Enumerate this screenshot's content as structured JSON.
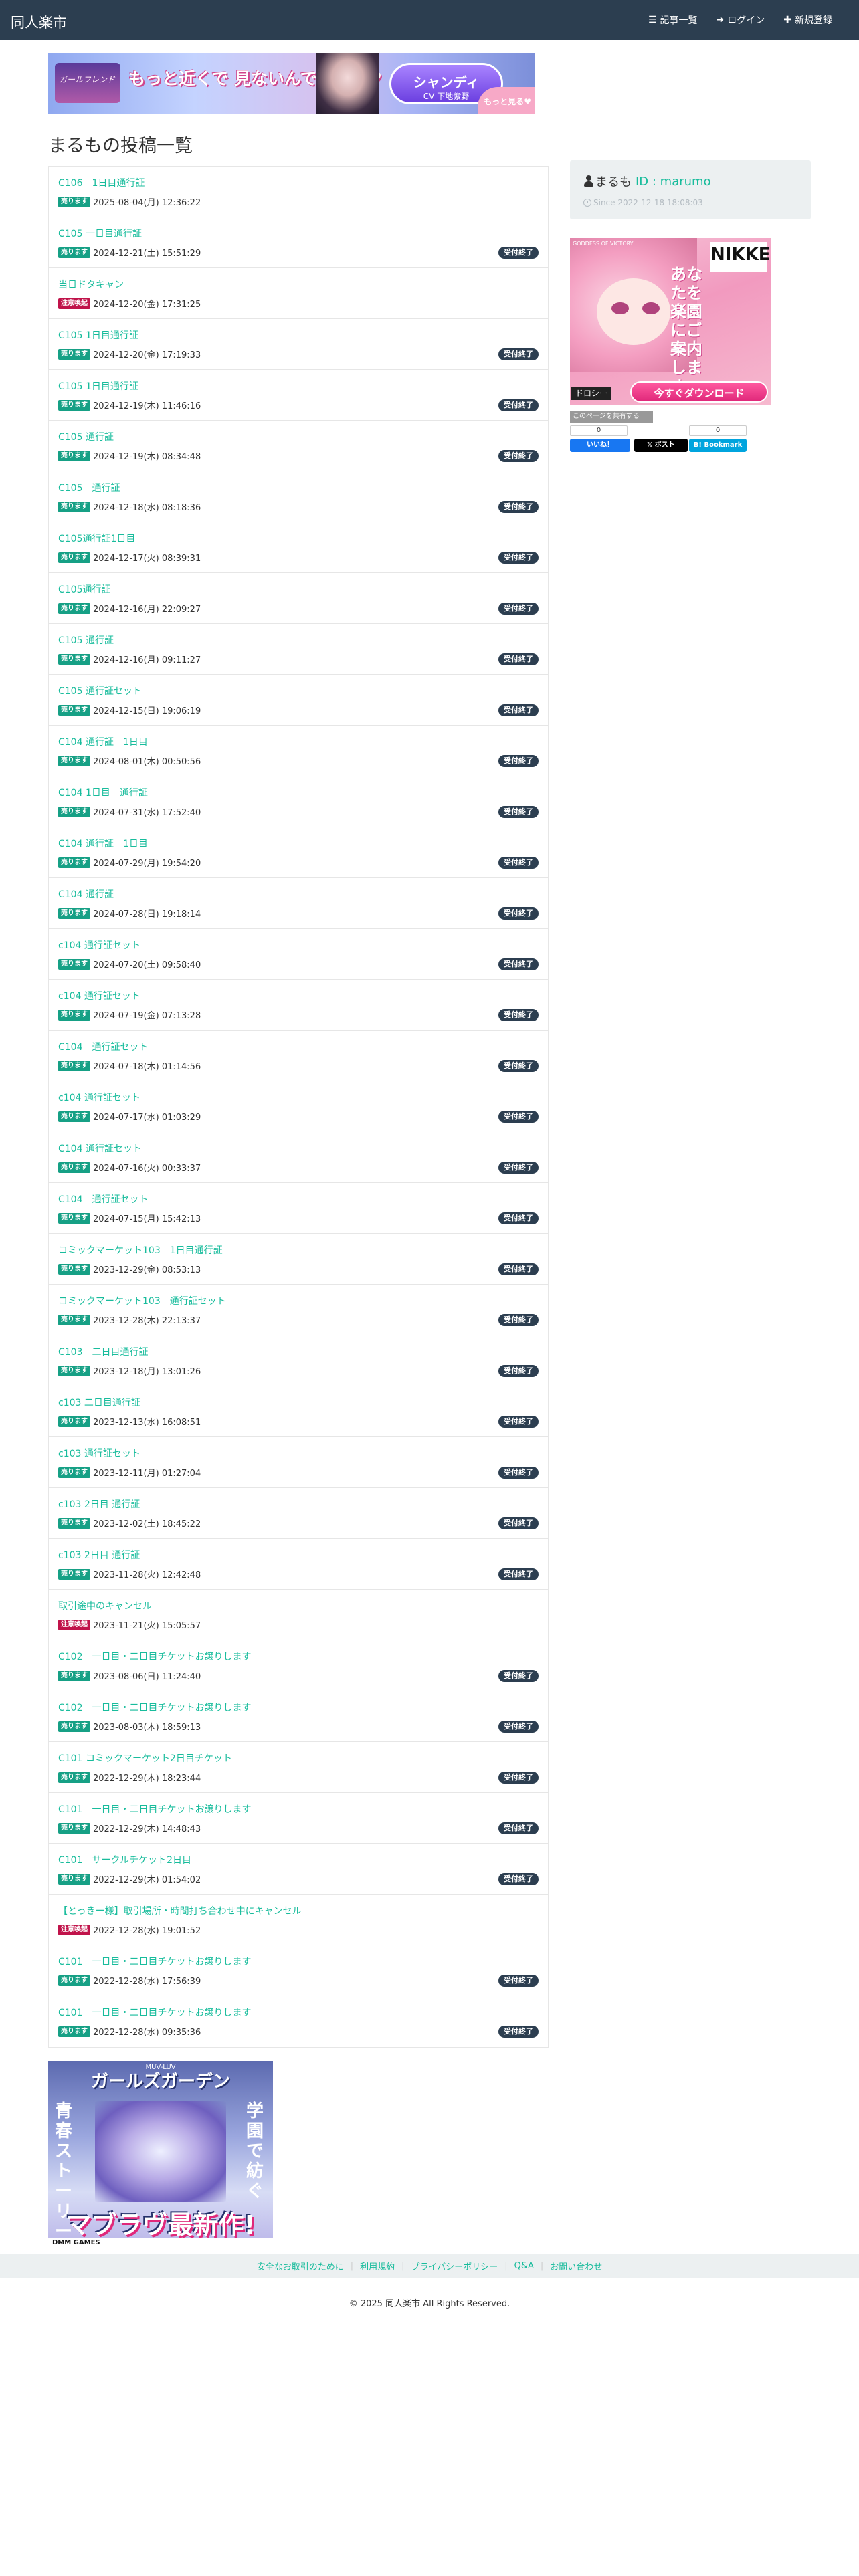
{
  "navbar": {
    "brand": "同人楽市",
    "links": [
      {
        "label": "記事一覧",
        "icon": "list-icon"
      },
      {
        "label": "ログイン",
        "icon": "login-icon"
      },
      {
        "label": "新規登録",
        "icon": "plus-icon"
      }
    ]
  },
  "ads": {
    "top_banner": {
      "logo": "ガールフレンド",
      "copy": "もっと近くで 見ないんですか？♥",
      "pill": "シャンディ",
      "pill_sub": "CV 下地紫野",
      "corner": "もっと見る♥"
    },
    "side": {
      "logo": "NIKKE",
      "tagline": "GODDESS OF VICTORY",
      "copy": "あなたを楽園にご案内します",
      "name": "ドロシー",
      "cta": "今すぐダウンロード"
    },
    "bottom": {
      "sub": "MUV-LUV",
      "title": "ガールズガーデン",
      "left": "青春ストーリー",
      "right": "学園で紡ぐ",
      "logo": "マブラヴ最新作!",
      "foot": "DMM GAMES"
    }
  },
  "page_title": "まるもの投稿一覧",
  "posts": [
    {
      "title": "C106　1日目通行証",
      "type": "売ります",
      "type_color": "#16a085",
      "date": "2025-08-04(月) 12:36:22",
      "status": ""
    },
    {
      "title": "C105 一日目通行証",
      "type": "売ります",
      "type_color": "#16a085",
      "date": "2024-12-21(土) 15:51:29",
      "status": "受付終了"
    },
    {
      "title": "当日ドタキャン",
      "type": "注意喚起",
      "type_color": "#c0134a",
      "date": "2024-12-20(金) 17:31:25",
      "status": ""
    },
    {
      "title": "C105 1日目通行証",
      "type": "売ります",
      "type_color": "#16a085",
      "date": "2024-12-20(金) 17:19:33",
      "status": "受付終了"
    },
    {
      "title": "C105 1日目通行証",
      "type": "売ります",
      "type_color": "#16a085",
      "date": "2024-12-19(木) 11:46:16",
      "status": "受付終了"
    },
    {
      "title": "C105 通行証",
      "type": "売ります",
      "type_color": "#16a085",
      "date": "2024-12-19(木) 08:34:48",
      "status": "受付終了"
    },
    {
      "title": "C105　通行証",
      "type": "売ります",
      "type_color": "#16a085",
      "date": "2024-12-18(水) 08:18:36",
      "status": "受付終了"
    },
    {
      "title": "C105通行証1日目",
      "type": "売ります",
      "type_color": "#16a085",
      "date": "2024-12-17(火) 08:39:31",
      "status": "受付終了"
    },
    {
      "title": "C105通行証",
      "type": "売ります",
      "type_color": "#16a085",
      "date": "2024-12-16(月) 22:09:27",
      "status": "受付終了"
    },
    {
      "title": "C105 通行証",
      "type": "売ります",
      "type_color": "#16a085",
      "date": "2024-12-16(月) 09:11:27",
      "status": "受付終了"
    },
    {
      "title": "C105 通行証セット",
      "type": "売ります",
      "type_color": "#16a085",
      "date": "2024-12-15(日) 19:06:19",
      "status": "受付終了"
    },
    {
      "title": "C104 通行証　1日目",
      "type": "売ります",
      "type_color": "#16a085",
      "date": "2024-08-01(木) 00:50:56",
      "status": "受付終了"
    },
    {
      "title": "C104 1日目　通行証",
      "type": "売ります",
      "type_color": "#16a085",
      "date": "2024-07-31(水) 17:52:40",
      "status": "受付終了"
    },
    {
      "title": "C104 通行証　1日目",
      "type": "売ります",
      "type_color": "#16a085",
      "date": "2024-07-29(月) 19:54:20",
      "status": "受付終了"
    },
    {
      "title": "C104 通行証",
      "type": "売ります",
      "type_color": "#16a085",
      "date": "2024-07-28(日) 19:18:14",
      "status": "受付終了"
    },
    {
      "title": "c104 通行証セット",
      "type": "売ります",
      "type_color": "#16a085",
      "date": "2024-07-20(土) 09:58:40",
      "status": "受付終了"
    },
    {
      "title": "c104 通行証セット",
      "type": "売ります",
      "type_color": "#16a085",
      "date": "2024-07-19(金) 07:13:28",
      "status": "受付終了"
    },
    {
      "title": "C104　通行証セット",
      "type": "売ります",
      "type_color": "#16a085",
      "date": "2024-07-18(木) 01:14:56",
      "status": "受付終了"
    },
    {
      "title": "c104 通行証セット",
      "type": "売ります",
      "type_color": "#16a085",
      "date": "2024-07-17(水) 01:03:29",
      "status": "受付終了"
    },
    {
      "title": "C104 通行証セット",
      "type": "売ります",
      "type_color": "#16a085",
      "date": "2024-07-16(火) 00:33:37",
      "status": "受付終了"
    },
    {
      "title": "C104　通行証セット",
      "type": "売ります",
      "type_color": "#16a085",
      "date": "2024-07-15(月) 15:42:13",
      "status": "受付終了"
    },
    {
      "title": "コミックマーケット103　1日目通行証",
      "type": "売ります",
      "type_color": "#16a085",
      "date": "2023-12-29(金) 08:53:13",
      "status": "受付終了"
    },
    {
      "title": "コミックマーケット103　通行証セット",
      "type": "売ります",
      "type_color": "#16a085",
      "date": "2023-12-28(木) 22:13:37",
      "status": "受付終了"
    },
    {
      "title": "C103　二日目通行証",
      "type": "売ります",
      "type_color": "#16a085",
      "date": "2023-12-18(月) 13:01:26",
      "status": "受付終了"
    },
    {
      "title": "c103 二日目通行証",
      "type": "売ります",
      "type_color": "#16a085",
      "date": "2023-12-13(水) 16:08:51",
      "status": "受付終了"
    },
    {
      "title": "c103 通行証セット",
      "type": "売ります",
      "type_color": "#16a085",
      "date": "2023-12-11(月) 01:27:04",
      "status": "受付終了"
    },
    {
      "title": "c103 2日目 通行証",
      "type": "売ります",
      "type_color": "#16a085",
      "date": "2023-12-02(土) 18:45:22",
      "status": "受付終了"
    },
    {
      "title": "c103 2日目 通行証",
      "type": "売ります",
      "type_color": "#16a085",
      "date": "2023-11-28(火) 12:42:48",
      "status": "受付終了"
    },
    {
      "title": "取引途中のキャンセル",
      "type": "注意喚起",
      "type_color": "#c0134a",
      "date": "2023-11-21(火) 15:05:57",
      "status": ""
    },
    {
      "title": "C102　一日目・二日目チケットお譲りします",
      "type": "売ります",
      "type_color": "#16a085",
      "date": "2023-08-06(日) 11:24:40",
      "status": "受付終了"
    },
    {
      "title": "C102　一日目・二日目チケットお譲りします",
      "type": "売ります",
      "type_color": "#16a085",
      "date": "2023-08-03(木) 18:59:13",
      "status": "受付終了"
    },
    {
      "title": "C101 コミックマーケット2日目チケット",
      "type": "売ります",
      "type_color": "#16a085",
      "date": "2022-12-29(木) 18:23:44",
      "status": "受付終了"
    },
    {
      "title": "C101　一日目・二日目チケットお譲りします",
      "type": "売ります",
      "type_color": "#16a085",
      "date": "2022-12-29(木) 14:48:43",
      "status": "受付終了"
    },
    {
      "title": "C101　サークルチケット2日目",
      "type": "売ります",
      "type_color": "#16a085",
      "date": "2022-12-29(木) 01:54:02",
      "status": "受付終了"
    },
    {
      "title": "【とっきー様】取引場所・時間打ち合わせ中にキャンセル",
      "type": "注意喚起",
      "type_color": "#c0134a",
      "date": "2022-12-28(水) 19:01:52",
      "status": ""
    },
    {
      "title": "C101　一日目・二日目チケットお譲りします",
      "type": "売ります",
      "type_color": "#16a085",
      "date": "2022-12-28(水) 17:56:39",
      "status": "受付終了"
    },
    {
      "title": "C101　一日目・二日目チケットお譲りします",
      "type": "売ります",
      "type_color": "#16a085",
      "date": "2022-12-28(水) 09:35:36",
      "status": "受付終了"
    }
  ],
  "profile": {
    "name": "まるも",
    "id": "ID : marumo",
    "since": "Since 2022-12-18 18:08:03"
  },
  "share": {
    "label": "このページを共有する",
    "counts": [
      "0",
      "",
      "0"
    ],
    "buttons": [
      {
        "label": "いいね！",
        "color": "#1877f2"
      },
      {
        "label": "ポスト",
        "color": "#000000"
      },
      {
        "label": "Bookmark",
        "color": "#00a4de"
      }
    ]
  },
  "footer": {
    "links": [
      "安全なお取引のために",
      "利用規約",
      "プライバシーポリシー",
      "Q&A",
      "お問い合わせ"
    ],
    "copyright": "© 2025 同人楽市 All Rights Reserved."
  }
}
